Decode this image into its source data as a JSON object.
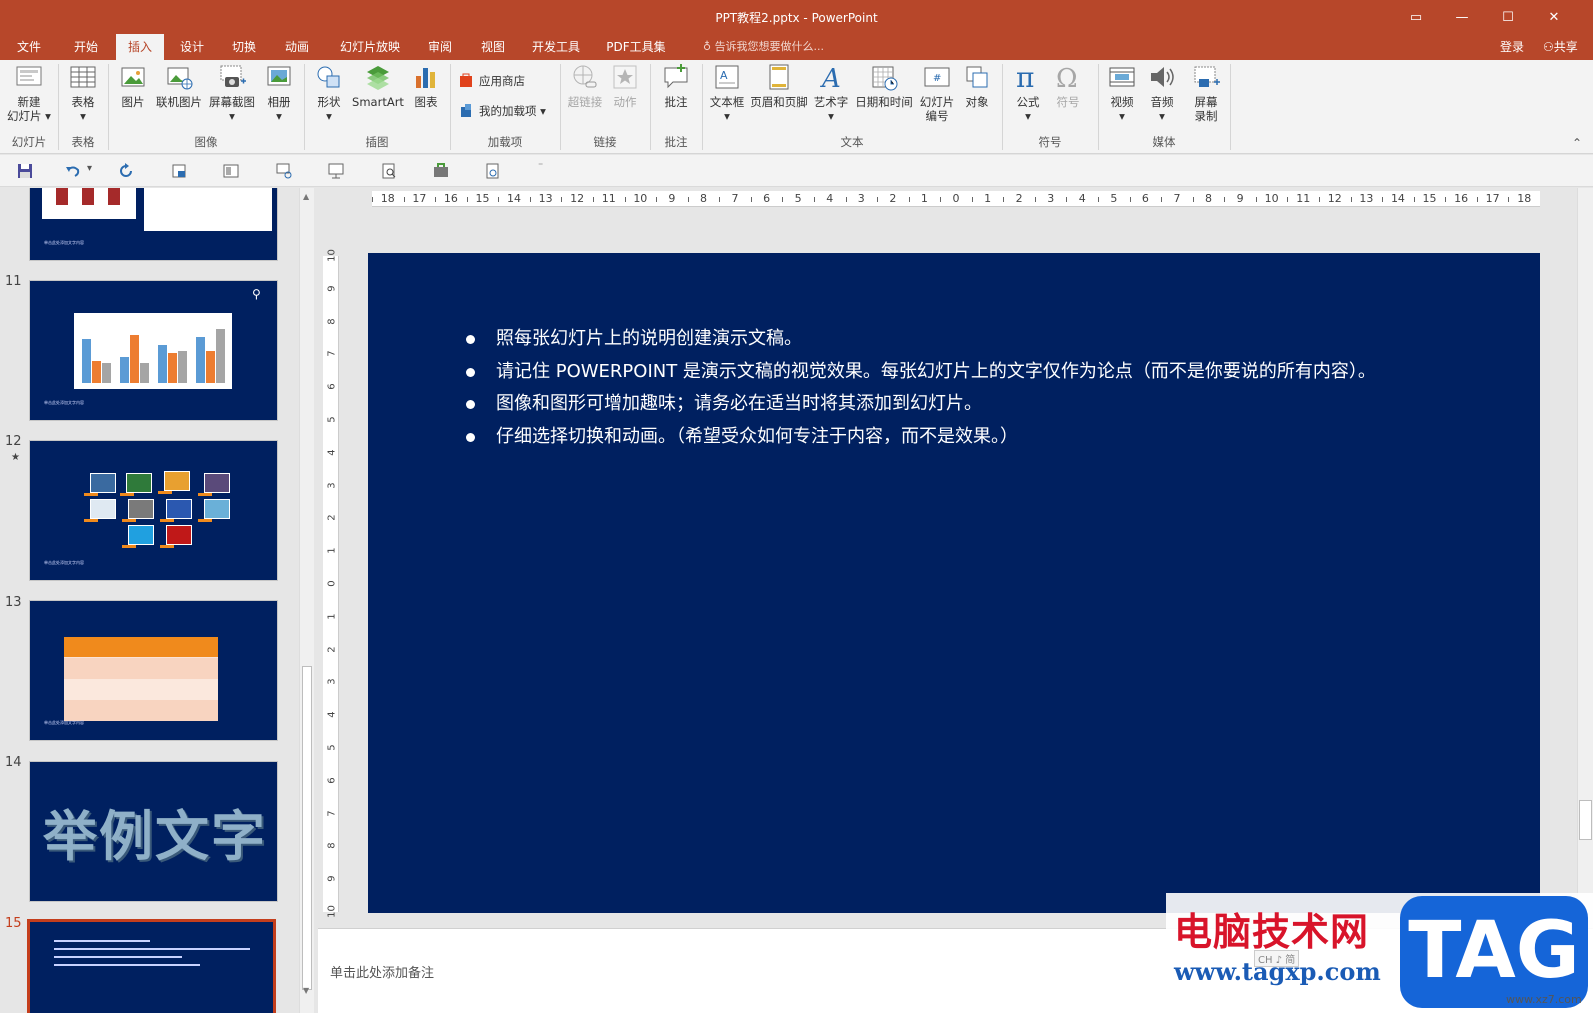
{
  "window": {
    "title": "PPT教程2.pptx - PowerPoint",
    "restore_label": "▭",
    "min_label": "—",
    "max_label": "☐",
    "close_label": "✕"
  },
  "tabs": [
    "文件",
    "开始",
    "插入",
    "设计",
    "切换",
    "动画",
    "幻灯片放映",
    "审阅",
    "视图",
    "开发工具",
    "PDF工具集"
  ],
  "active_tab": "插入",
  "tellme": "告诉我您想要做什么...",
  "login": "登录",
  "share": "共享",
  "ribbon": {
    "new_slide": "新建",
    "new_slide2": "幻灯片",
    "table": "表格",
    "picture": "图片",
    "online_picture": "联机图片",
    "screenshot": "屏幕截图",
    "album": "相册",
    "shapes": "形状",
    "smartart": "SmartArt",
    "chart": "图表",
    "store": "应用商店",
    "my_addins": "我的加载项",
    "hyperlink": "超链接",
    "action": "动作",
    "comment": "批注",
    "textbox": "文本框",
    "header_footer": "页眉和页脚",
    "wordart": "艺术字",
    "datetime": "日期和时间",
    "slide_number": "幻灯片",
    "slide_number2": "编号",
    "object": "对象",
    "equation": "公式",
    "symbol": "符号",
    "video": "视频",
    "audio": "音频",
    "screen_record": "屏幕",
    "screen_record2": "录制",
    "groups": {
      "slides": "幻灯片",
      "tables": "表格",
      "images": "图像",
      "illustrations": "插图",
      "addins": "加载项",
      "links": "链接",
      "comments": "批注",
      "text": "文本",
      "symbols": "符号",
      "media": "媒体"
    }
  },
  "ruler": {
    "h_ticks": [
      "18",
      "17",
      "16",
      "15",
      "14",
      "13",
      "12",
      "11",
      "10",
      "9",
      "8",
      "7",
      "6",
      "5",
      "4",
      "3",
      "2",
      "1",
      "0",
      "1",
      "2",
      "3",
      "4",
      "5",
      "6",
      "7",
      "8",
      "9",
      "10",
      "11",
      "12",
      "13",
      "14",
      "15",
      "16",
      "17",
      "18"
    ],
    "v_ticks": [
      "10",
      "9",
      "8",
      "7",
      "6",
      "5",
      "4",
      "3",
      "2",
      "1",
      "0",
      "1",
      "2",
      "3",
      "4",
      "5",
      "6",
      "7",
      "8",
      "9",
      "10"
    ]
  },
  "thumbnails": [
    {
      "num": "",
      "caption": "单击此处添加文字内容"
    },
    {
      "num": "11",
      "caption": "单击此处添加文字内容"
    },
    {
      "num": "12",
      "star": "★",
      "caption": "单击此处添加文字内容"
    },
    {
      "num": "13",
      "caption": "单击此处添加文字内容"
    },
    {
      "num": "14",
      "art": "举例文字"
    },
    {
      "num": "15"
    }
  ],
  "slide": {
    "bullets": [
      "照每张幻灯片上的说明创建演示文稿。",
      "请记住 POWERPOINT 是演示文稿的视觉效果。每张幻灯片上的文字仅作为论点（而不是你要说的所有内容）。",
      "图像和图形可增加趣味；请务必在适当时将其添加到幻灯片。",
      "仔细选择切换和动画。（希望受众如何专注于内容，而不是效果。）"
    ]
  },
  "notes_placeholder": "单击此处添加备注",
  "watermark": {
    "cn": "电脑技术网",
    "url": "www.tagxp.com",
    "tag": "TAG",
    "site": "www.xz7.com",
    "ime": "CH ♪ 简"
  },
  "colors": {
    "accent": "#b7472a",
    "slide_bg": "#002060",
    "selected": "#c43e1c"
  }
}
